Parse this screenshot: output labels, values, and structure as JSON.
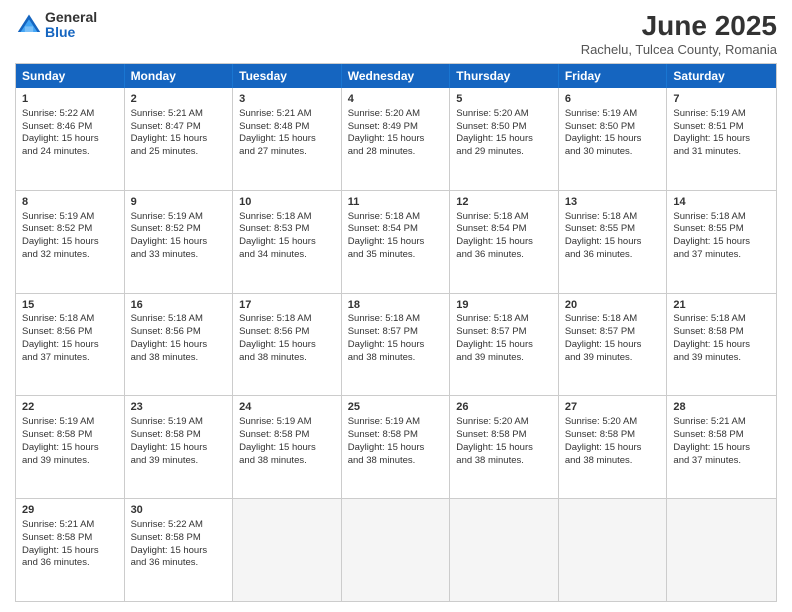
{
  "logo": {
    "general": "General",
    "blue": "Blue"
  },
  "title": "June 2025",
  "subtitle": "Rachelu, Tulcea County, Romania",
  "header_days": [
    "Sunday",
    "Monday",
    "Tuesday",
    "Wednesday",
    "Thursday",
    "Friday",
    "Saturday"
  ],
  "rows": [
    [
      {
        "day": "1",
        "lines": [
          "Sunrise: 5:22 AM",
          "Sunset: 8:46 PM",
          "Daylight: 15 hours",
          "and 24 minutes."
        ]
      },
      {
        "day": "2",
        "lines": [
          "Sunrise: 5:21 AM",
          "Sunset: 8:47 PM",
          "Daylight: 15 hours",
          "and 25 minutes."
        ]
      },
      {
        "day": "3",
        "lines": [
          "Sunrise: 5:21 AM",
          "Sunset: 8:48 PM",
          "Daylight: 15 hours",
          "and 27 minutes."
        ]
      },
      {
        "day": "4",
        "lines": [
          "Sunrise: 5:20 AM",
          "Sunset: 8:49 PM",
          "Daylight: 15 hours",
          "and 28 minutes."
        ]
      },
      {
        "day": "5",
        "lines": [
          "Sunrise: 5:20 AM",
          "Sunset: 8:50 PM",
          "Daylight: 15 hours",
          "and 29 minutes."
        ]
      },
      {
        "day": "6",
        "lines": [
          "Sunrise: 5:19 AM",
          "Sunset: 8:50 PM",
          "Daylight: 15 hours",
          "and 30 minutes."
        ]
      },
      {
        "day": "7",
        "lines": [
          "Sunrise: 5:19 AM",
          "Sunset: 8:51 PM",
          "Daylight: 15 hours",
          "and 31 minutes."
        ]
      }
    ],
    [
      {
        "day": "8",
        "lines": [
          "Sunrise: 5:19 AM",
          "Sunset: 8:52 PM",
          "Daylight: 15 hours",
          "and 32 minutes."
        ]
      },
      {
        "day": "9",
        "lines": [
          "Sunrise: 5:19 AM",
          "Sunset: 8:52 PM",
          "Daylight: 15 hours",
          "and 33 minutes."
        ]
      },
      {
        "day": "10",
        "lines": [
          "Sunrise: 5:18 AM",
          "Sunset: 8:53 PM",
          "Daylight: 15 hours",
          "and 34 minutes."
        ]
      },
      {
        "day": "11",
        "lines": [
          "Sunrise: 5:18 AM",
          "Sunset: 8:54 PM",
          "Daylight: 15 hours",
          "and 35 minutes."
        ]
      },
      {
        "day": "12",
        "lines": [
          "Sunrise: 5:18 AM",
          "Sunset: 8:54 PM",
          "Daylight: 15 hours",
          "and 36 minutes."
        ]
      },
      {
        "day": "13",
        "lines": [
          "Sunrise: 5:18 AM",
          "Sunset: 8:55 PM",
          "Daylight: 15 hours",
          "and 36 minutes."
        ]
      },
      {
        "day": "14",
        "lines": [
          "Sunrise: 5:18 AM",
          "Sunset: 8:55 PM",
          "Daylight: 15 hours",
          "and 37 minutes."
        ]
      }
    ],
    [
      {
        "day": "15",
        "lines": [
          "Sunrise: 5:18 AM",
          "Sunset: 8:56 PM",
          "Daylight: 15 hours",
          "and 37 minutes."
        ]
      },
      {
        "day": "16",
        "lines": [
          "Sunrise: 5:18 AM",
          "Sunset: 8:56 PM",
          "Daylight: 15 hours",
          "and 38 minutes."
        ]
      },
      {
        "day": "17",
        "lines": [
          "Sunrise: 5:18 AM",
          "Sunset: 8:56 PM",
          "Daylight: 15 hours",
          "and 38 minutes."
        ]
      },
      {
        "day": "18",
        "lines": [
          "Sunrise: 5:18 AM",
          "Sunset: 8:57 PM",
          "Daylight: 15 hours",
          "and 38 minutes."
        ]
      },
      {
        "day": "19",
        "lines": [
          "Sunrise: 5:18 AM",
          "Sunset: 8:57 PM",
          "Daylight: 15 hours",
          "and 39 minutes."
        ]
      },
      {
        "day": "20",
        "lines": [
          "Sunrise: 5:18 AM",
          "Sunset: 8:57 PM",
          "Daylight: 15 hours",
          "and 39 minutes."
        ]
      },
      {
        "day": "21",
        "lines": [
          "Sunrise: 5:18 AM",
          "Sunset: 8:58 PM",
          "Daylight: 15 hours",
          "and 39 minutes."
        ]
      }
    ],
    [
      {
        "day": "22",
        "lines": [
          "Sunrise: 5:19 AM",
          "Sunset: 8:58 PM",
          "Daylight: 15 hours",
          "and 39 minutes."
        ]
      },
      {
        "day": "23",
        "lines": [
          "Sunrise: 5:19 AM",
          "Sunset: 8:58 PM",
          "Daylight: 15 hours",
          "and 39 minutes."
        ]
      },
      {
        "day": "24",
        "lines": [
          "Sunrise: 5:19 AM",
          "Sunset: 8:58 PM",
          "Daylight: 15 hours",
          "and 38 minutes."
        ]
      },
      {
        "day": "25",
        "lines": [
          "Sunrise: 5:19 AM",
          "Sunset: 8:58 PM",
          "Daylight: 15 hours",
          "and 38 minutes."
        ]
      },
      {
        "day": "26",
        "lines": [
          "Sunrise: 5:20 AM",
          "Sunset: 8:58 PM",
          "Daylight: 15 hours",
          "and 38 minutes."
        ]
      },
      {
        "day": "27",
        "lines": [
          "Sunrise: 5:20 AM",
          "Sunset: 8:58 PM",
          "Daylight: 15 hours",
          "and 38 minutes."
        ]
      },
      {
        "day": "28",
        "lines": [
          "Sunrise: 5:21 AM",
          "Sunset: 8:58 PM",
          "Daylight: 15 hours",
          "and 37 minutes."
        ]
      }
    ],
    [
      {
        "day": "29",
        "lines": [
          "Sunrise: 5:21 AM",
          "Sunset: 8:58 PM",
          "Daylight: 15 hours",
          "and 36 minutes."
        ]
      },
      {
        "day": "30",
        "lines": [
          "Sunrise: 5:22 AM",
          "Sunset: 8:58 PM",
          "Daylight: 15 hours",
          "and 36 minutes."
        ]
      },
      {
        "day": "",
        "lines": []
      },
      {
        "day": "",
        "lines": []
      },
      {
        "day": "",
        "lines": []
      },
      {
        "day": "",
        "lines": []
      },
      {
        "day": "",
        "lines": []
      }
    ]
  ]
}
